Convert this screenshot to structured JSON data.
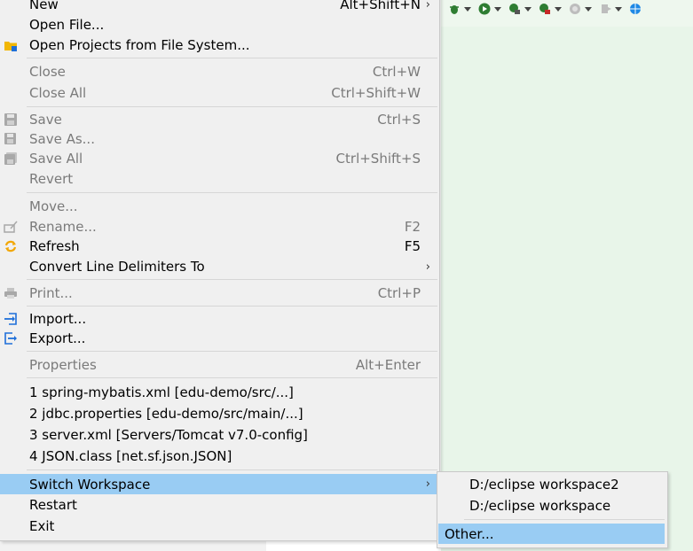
{
  "colors": {
    "highlight": "#99ccf3",
    "menu_bg": "#f0f0f0",
    "disabled_text": "#7a7a7a",
    "editor_bg": "#e8f5e9"
  },
  "menu": {
    "items": [
      {
        "label": "New",
        "accel": "Alt+Shift+N",
        "submenu": true,
        "enabled": true,
        "icon": ""
      },
      {
        "label": "Open File...",
        "accel": "",
        "enabled": true,
        "icon": ""
      },
      {
        "label": "Open Projects from File System...",
        "accel": "",
        "enabled": true,
        "icon": "folder-icon"
      },
      {
        "label": "Close",
        "accel": "Ctrl+W",
        "enabled": false,
        "icon": ""
      },
      {
        "label": "Close All",
        "accel": "Ctrl+Shift+W",
        "enabled": false,
        "icon": ""
      },
      {
        "label": "Save",
        "accel": "Ctrl+S",
        "enabled": false,
        "icon": "save-icon"
      },
      {
        "label": "Save As...",
        "accel": "",
        "enabled": false,
        "icon": "save-as-icon"
      },
      {
        "label": "Save All",
        "accel": "Ctrl+Shift+S",
        "enabled": false,
        "icon": "save-all-icon"
      },
      {
        "label": "Revert",
        "accel": "",
        "enabled": false,
        "icon": ""
      },
      {
        "label": "Move...",
        "accel": "",
        "enabled": false,
        "icon": ""
      },
      {
        "label": "Rename...",
        "accel": "F2",
        "enabled": false,
        "icon": "rename-icon"
      },
      {
        "label": "Refresh",
        "accel": "F5",
        "enabled": true,
        "icon": "refresh-icon"
      },
      {
        "label": "Convert Line Delimiters To",
        "accel": "",
        "submenu": true,
        "enabled": true,
        "icon": ""
      },
      {
        "label": "Print...",
        "accel": "Ctrl+P",
        "enabled": false,
        "icon": "print-icon"
      },
      {
        "label": "Import...",
        "accel": "",
        "enabled": true,
        "icon": "import-icon"
      },
      {
        "label": "Export...",
        "accel": "",
        "enabled": true,
        "icon": "export-icon"
      },
      {
        "label": "Properties",
        "accel": "Alt+Enter",
        "enabled": false,
        "icon": ""
      },
      {
        "label": "1 spring-mybatis.xml  [edu-demo/src/...]",
        "accel": "",
        "enabled": true,
        "icon": ""
      },
      {
        "label": "2 jdbc.properties  [edu-demo/src/main/...]",
        "accel": "",
        "enabled": true,
        "icon": ""
      },
      {
        "label": "3 server.xml  [Servers/Tomcat v7.0-config]",
        "accel": "",
        "enabled": true,
        "icon": ""
      },
      {
        "label": "4 JSON.class  [net.sf.json.JSON]",
        "accel": "",
        "enabled": true,
        "icon": ""
      },
      {
        "label": "Switch Workspace",
        "accel": "",
        "submenu": true,
        "enabled": true,
        "highlighted": true,
        "icon": ""
      },
      {
        "label": "Restart",
        "accel": "",
        "enabled": true,
        "icon": ""
      },
      {
        "label": "Exit",
        "accel": "",
        "enabled": true,
        "icon": ""
      }
    ],
    "submenu_arrow": "›"
  },
  "workspace_submenu": {
    "items": [
      {
        "label": "D:/eclipse workspace2"
      },
      {
        "label": "D:/eclipse workspace"
      },
      {
        "label": "Other...",
        "highlighted": true
      }
    ]
  }
}
